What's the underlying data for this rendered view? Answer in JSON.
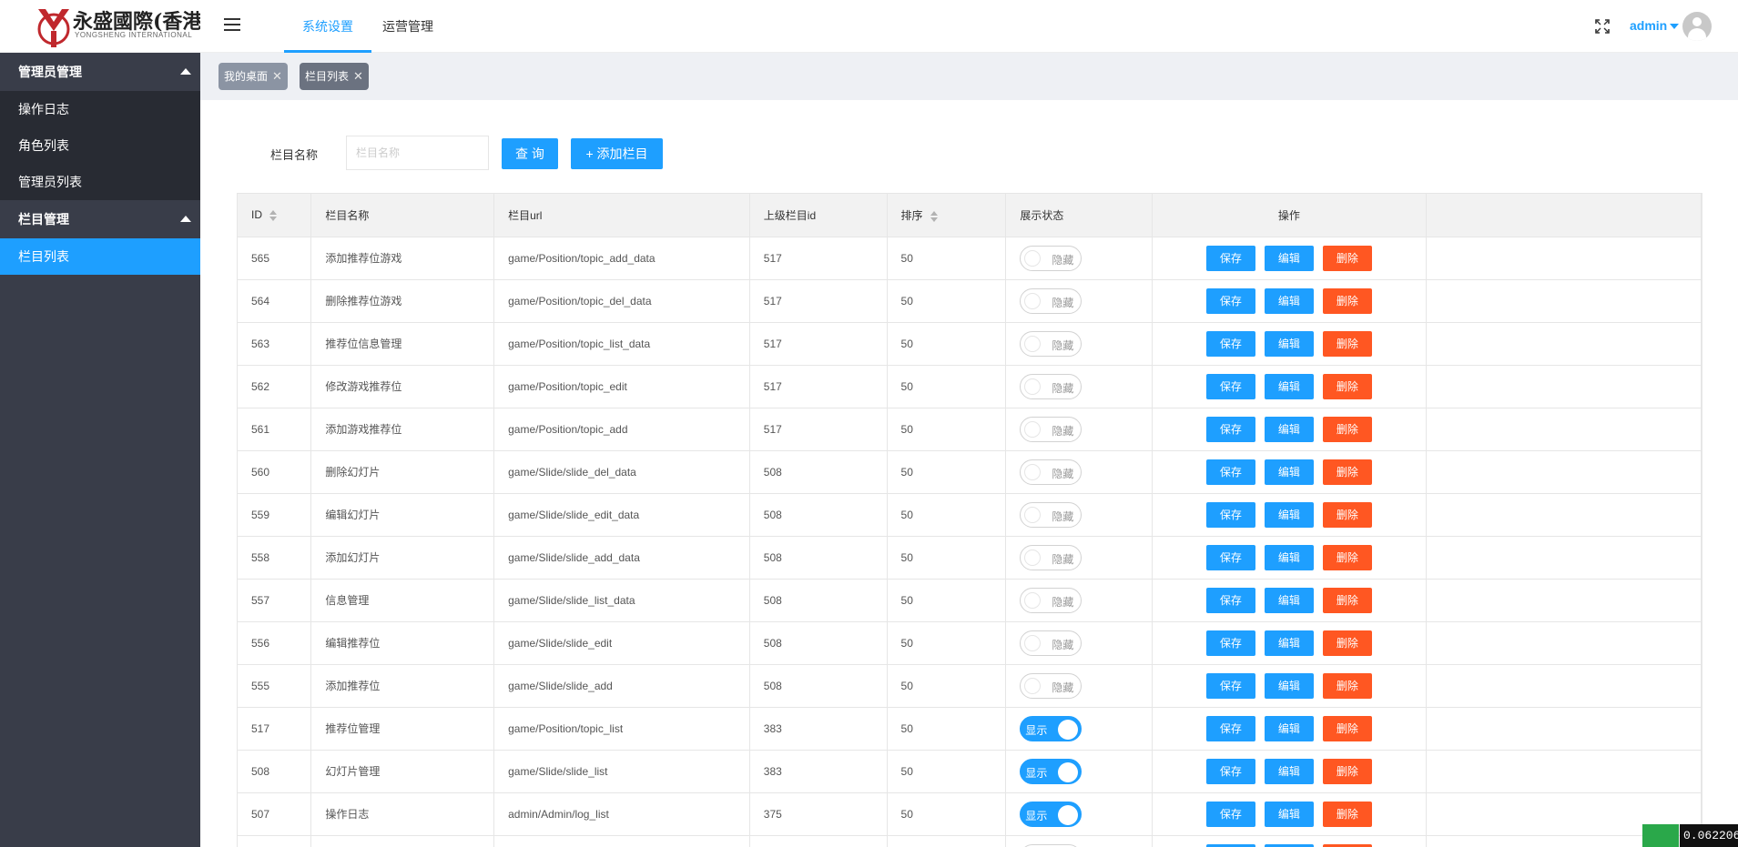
{
  "logo": {
    "title": "永盛國際(香港)",
    "subtitle": "YONGSHENG INTERNATIONAL"
  },
  "sidebar": {
    "groups": [
      {
        "label": "管理员管理",
        "items": [
          "操作日志",
          "角色列表",
          "管理员列表"
        ]
      },
      {
        "label": "栏目管理",
        "items": [
          "栏目列表"
        ]
      }
    ]
  },
  "header": {
    "top_tabs": [
      "系统设置",
      "运营管理"
    ],
    "user": "admin"
  },
  "page_tabs": [
    "我的桌面",
    "栏目列表"
  ],
  "search": {
    "label": "栏目名称",
    "placeholder": "栏目名称",
    "query_btn": "查 询",
    "add_btn": "+ 添加栏目"
  },
  "table": {
    "headers": [
      "ID",
      "栏目名称",
      "栏目url",
      "上级栏目id",
      "排序",
      "展示状态",
      "操作"
    ],
    "switch_on": "显示",
    "switch_off": "隐藏",
    "ops": {
      "save": "保存",
      "edit": "编辑",
      "delete": "删除"
    },
    "rows": [
      {
        "id": "565",
        "name": "添加推荐位游戏",
        "url": "game/Position/topic_add_data",
        "pid": "517",
        "sort": "50",
        "show": false
      },
      {
        "id": "564",
        "name": "删除推荐位游戏",
        "url": "game/Position/topic_del_data",
        "pid": "517",
        "sort": "50",
        "show": false
      },
      {
        "id": "563",
        "name": "推荐位信息管理",
        "url": "game/Position/topic_list_data",
        "pid": "517",
        "sort": "50",
        "show": false
      },
      {
        "id": "562",
        "name": "修改游戏推荐位",
        "url": "game/Position/topic_edit",
        "pid": "517",
        "sort": "50",
        "show": false
      },
      {
        "id": "561",
        "name": "添加游戏推荐位",
        "url": "game/Position/topic_add",
        "pid": "517",
        "sort": "50",
        "show": false
      },
      {
        "id": "560",
        "name": "删除幻灯片",
        "url": "game/Slide/slide_del_data",
        "pid": "508",
        "sort": "50",
        "show": false
      },
      {
        "id": "559",
        "name": "编辑幻灯片",
        "url": "game/Slide/slide_edit_data",
        "pid": "508",
        "sort": "50",
        "show": false
      },
      {
        "id": "558",
        "name": "添加幻灯片",
        "url": "game/Slide/slide_add_data",
        "pid": "508",
        "sort": "50",
        "show": false
      },
      {
        "id": "557",
        "name": "信息管理",
        "url": "game/Slide/slide_list_data",
        "pid": "508",
        "sort": "50",
        "show": false
      },
      {
        "id": "556",
        "name": "编辑推荐位",
        "url": "game/Slide/slide_edit",
        "pid": "508",
        "sort": "50",
        "show": false
      },
      {
        "id": "555",
        "name": "添加推荐位",
        "url": "game/Slide/slide_add",
        "pid": "508",
        "sort": "50",
        "show": false
      },
      {
        "id": "517",
        "name": "推荐位管理",
        "url": "game/Position/topic_list",
        "pid": "383",
        "sort": "50",
        "show": true
      },
      {
        "id": "508",
        "name": "幻灯片管理",
        "url": "game/Slide/slide_list",
        "pid": "383",
        "sort": "50",
        "show": true
      },
      {
        "id": "507",
        "name": "操作日志",
        "url": "admin/Admin/log_list",
        "pid": "375",
        "sort": "50",
        "show": true
      },
      {
        "id": "",
        "name": "",
        "url": "",
        "pid": "",
        "sort": "",
        "show": false
      }
    ]
  },
  "corner_badge": "0.062206",
  "colors": {
    "primary": "#1E9FFF",
    "danger": "#FF5722",
    "sidebar": "#393D49",
    "sidebar_sub": "#282B33"
  }
}
